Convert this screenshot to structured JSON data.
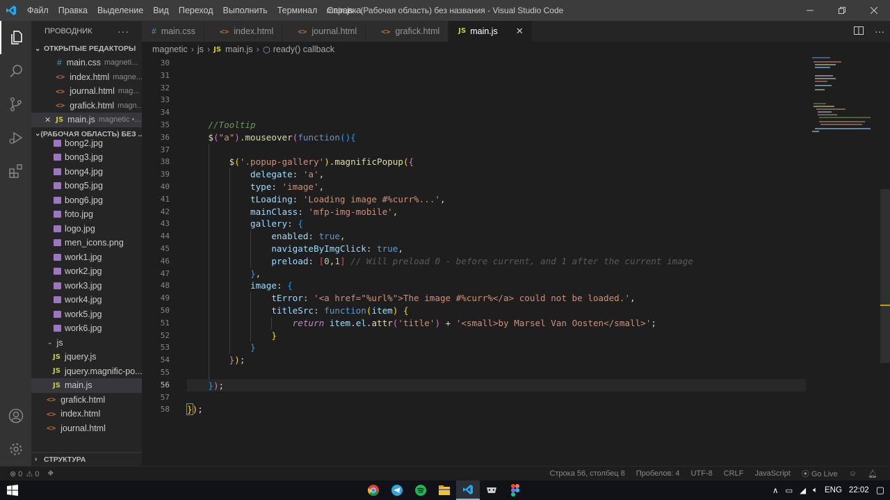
{
  "titlebar": {
    "menu": [
      "Файл",
      "Правка",
      "Выделение",
      "Вид",
      "Переход",
      "Выполнить",
      "Терминал",
      "Справка"
    ],
    "title": "main.js - (Рабочая область) без названия - Visual Studio Code"
  },
  "sidebar": {
    "header": "ПРОВОДНИК",
    "open_editors_title": "ОТКРЫТЫЕ РЕДАКТОРЫ",
    "open_editors": [
      {
        "name": "main.css",
        "desc": "magneti...",
        "icon": "css"
      },
      {
        "name": "index.html",
        "desc": "magne...",
        "icon": "html"
      },
      {
        "name": "journal.html",
        "desc": "mag...",
        "icon": "html"
      },
      {
        "name": "grafick.html",
        "desc": "magn...",
        "icon": "html"
      },
      {
        "name": "main.js",
        "desc": "magnetic •...",
        "icon": "js"
      }
    ],
    "workspace_title": "(РАБОЧАЯ ОБЛАСТЬ) БЕЗ ...",
    "files": [
      "bong2.jpg",
      "bong3.jpg",
      "bong4.jpg",
      "bong5.jpg",
      "bong6.jpg",
      "foto.jpg",
      "logo.jpg",
      "men_icons.png",
      "work1.jpg",
      "work2.jpg",
      "work3.jpg",
      "work4.jpg",
      "work5.jpg",
      "work6.jpg"
    ],
    "js_folder": "js",
    "js_files": [
      "jquery.js",
      "jquery.magnific-po...",
      "main.js"
    ],
    "root_files": [
      "grafick.html",
      "index.html",
      "journal.html"
    ],
    "outline_title": "СТРУКТУРА"
  },
  "tabs": [
    {
      "label": "main.css",
      "icon": "css"
    },
    {
      "label": "index.html",
      "icon": "html"
    },
    {
      "label": "journal.html",
      "icon": "html"
    },
    {
      "label": "grafick.html",
      "icon": "html"
    },
    {
      "label": "main.js",
      "icon": "js",
      "active": true
    }
  ],
  "breadcrumbs": [
    "magnetic",
    "js",
    "main.js",
    "ready() callback"
  ],
  "editor": {
    "line_numbers": [
      "30",
      "31",
      "32",
      "33",
      "34",
      "35",
      "36",
      "37",
      "38",
      "39",
      "40",
      "41",
      "42",
      "43",
      "44",
      "45",
      "46",
      "47",
      "48",
      "49",
      "50",
      "51",
      "52",
      "53",
      "54",
      "55",
      "56",
      "57",
      "58"
    ],
    "current_line": "56"
  },
  "statusbar": {
    "errors": "0",
    "warnings": "0",
    "position": "Строка 56, столбец 8",
    "spaces": "Пробелов: 4",
    "encoding": "UTF-8",
    "eol": "CRLF",
    "language": "JavaScript",
    "live": "Go Live"
  },
  "taskbar": {
    "lang": "ENG",
    "time": "22:02"
  },
  "colors": {
    "accent": "#007acc",
    "js_icon": "#cbcb41",
    "html_icon": "#e37933",
    "css_icon": "#519aba"
  }
}
